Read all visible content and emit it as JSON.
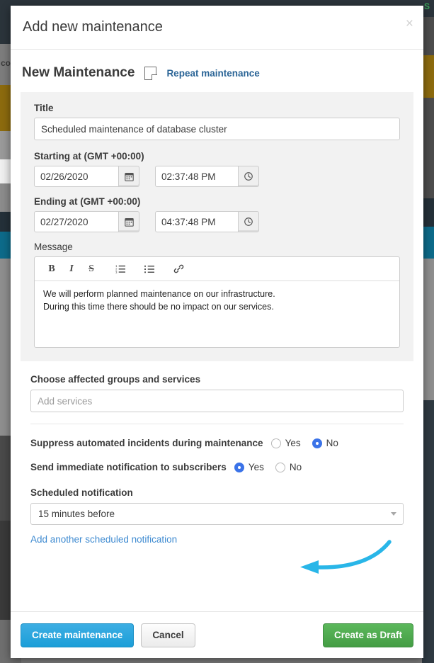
{
  "modal": {
    "title": "Add new maintenance",
    "close_label": "×",
    "section": {
      "heading": "New Maintenance",
      "repeat_link": "Repeat maintenance",
      "repeat_icon": "page-corner-icon"
    },
    "title_field": {
      "label": "Title",
      "value": "Scheduled maintenance of database cluster",
      "placeholder": ""
    },
    "starting": {
      "label": "Starting at (GMT +00:00)",
      "date": "02/26/2020",
      "time": "02:37:48 PM",
      "calendar_icon": "calendar-icon",
      "clock_icon": "clock-icon"
    },
    "ending": {
      "label": "Ending at (GMT +00:00)",
      "date": "02/27/2020",
      "time": "04:37:48 PM",
      "calendar_icon": "calendar-icon",
      "clock_icon": "clock-icon"
    },
    "message": {
      "label": "Message",
      "toolbar": [
        {
          "name": "bold-icon",
          "glyph": "B"
        },
        {
          "name": "italic-icon",
          "glyph": "I"
        },
        {
          "name": "strikethrough-icon",
          "glyph": "S"
        },
        {
          "name": "ordered-list-icon",
          "glyph": "≡"
        },
        {
          "name": "unordered-list-icon",
          "glyph": "☰"
        },
        {
          "name": "link-icon",
          "glyph": "🔗"
        }
      ],
      "line1": "We will perform planned maintenance on our infrastructure.",
      "line2": "During this time there should be no impact on our services."
    },
    "services": {
      "label": "Choose affected groups and services",
      "placeholder": "Add services",
      "value": ""
    },
    "suppress": {
      "label": "Suppress automated incidents during maintenance",
      "options": [
        "Yes",
        "No"
      ],
      "selected": "No"
    },
    "notify": {
      "label": "Send immediate notification to subscribers",
      "options": [
        "Yes",
        "No"
      ],
      "selected": "Yes"
    },
    "scheduled_notification": {
      "label": "Scheduled notification",
      "value": "15 minutes before",
      "add_link": "Add another scheduled notification"
    },
    "footer": {
      "primary": "Create maintenance",
      "cancel": "Cancel",
      "draft": "Create as Draft"
    }
  },
  "background": {
    "letter_right": "S",
    "letter_left": "co"
  },
  "colors": {
    "primary_blue": "#1b9ed8",
    "success_green": "#449d44",
    "radio_blue": "#3b73e8",
    "link_blue": "#2a6496",
    "annotation_cyan": "#29b6e8",
    "panel_gray": "#f2f2f2"
  }
}
